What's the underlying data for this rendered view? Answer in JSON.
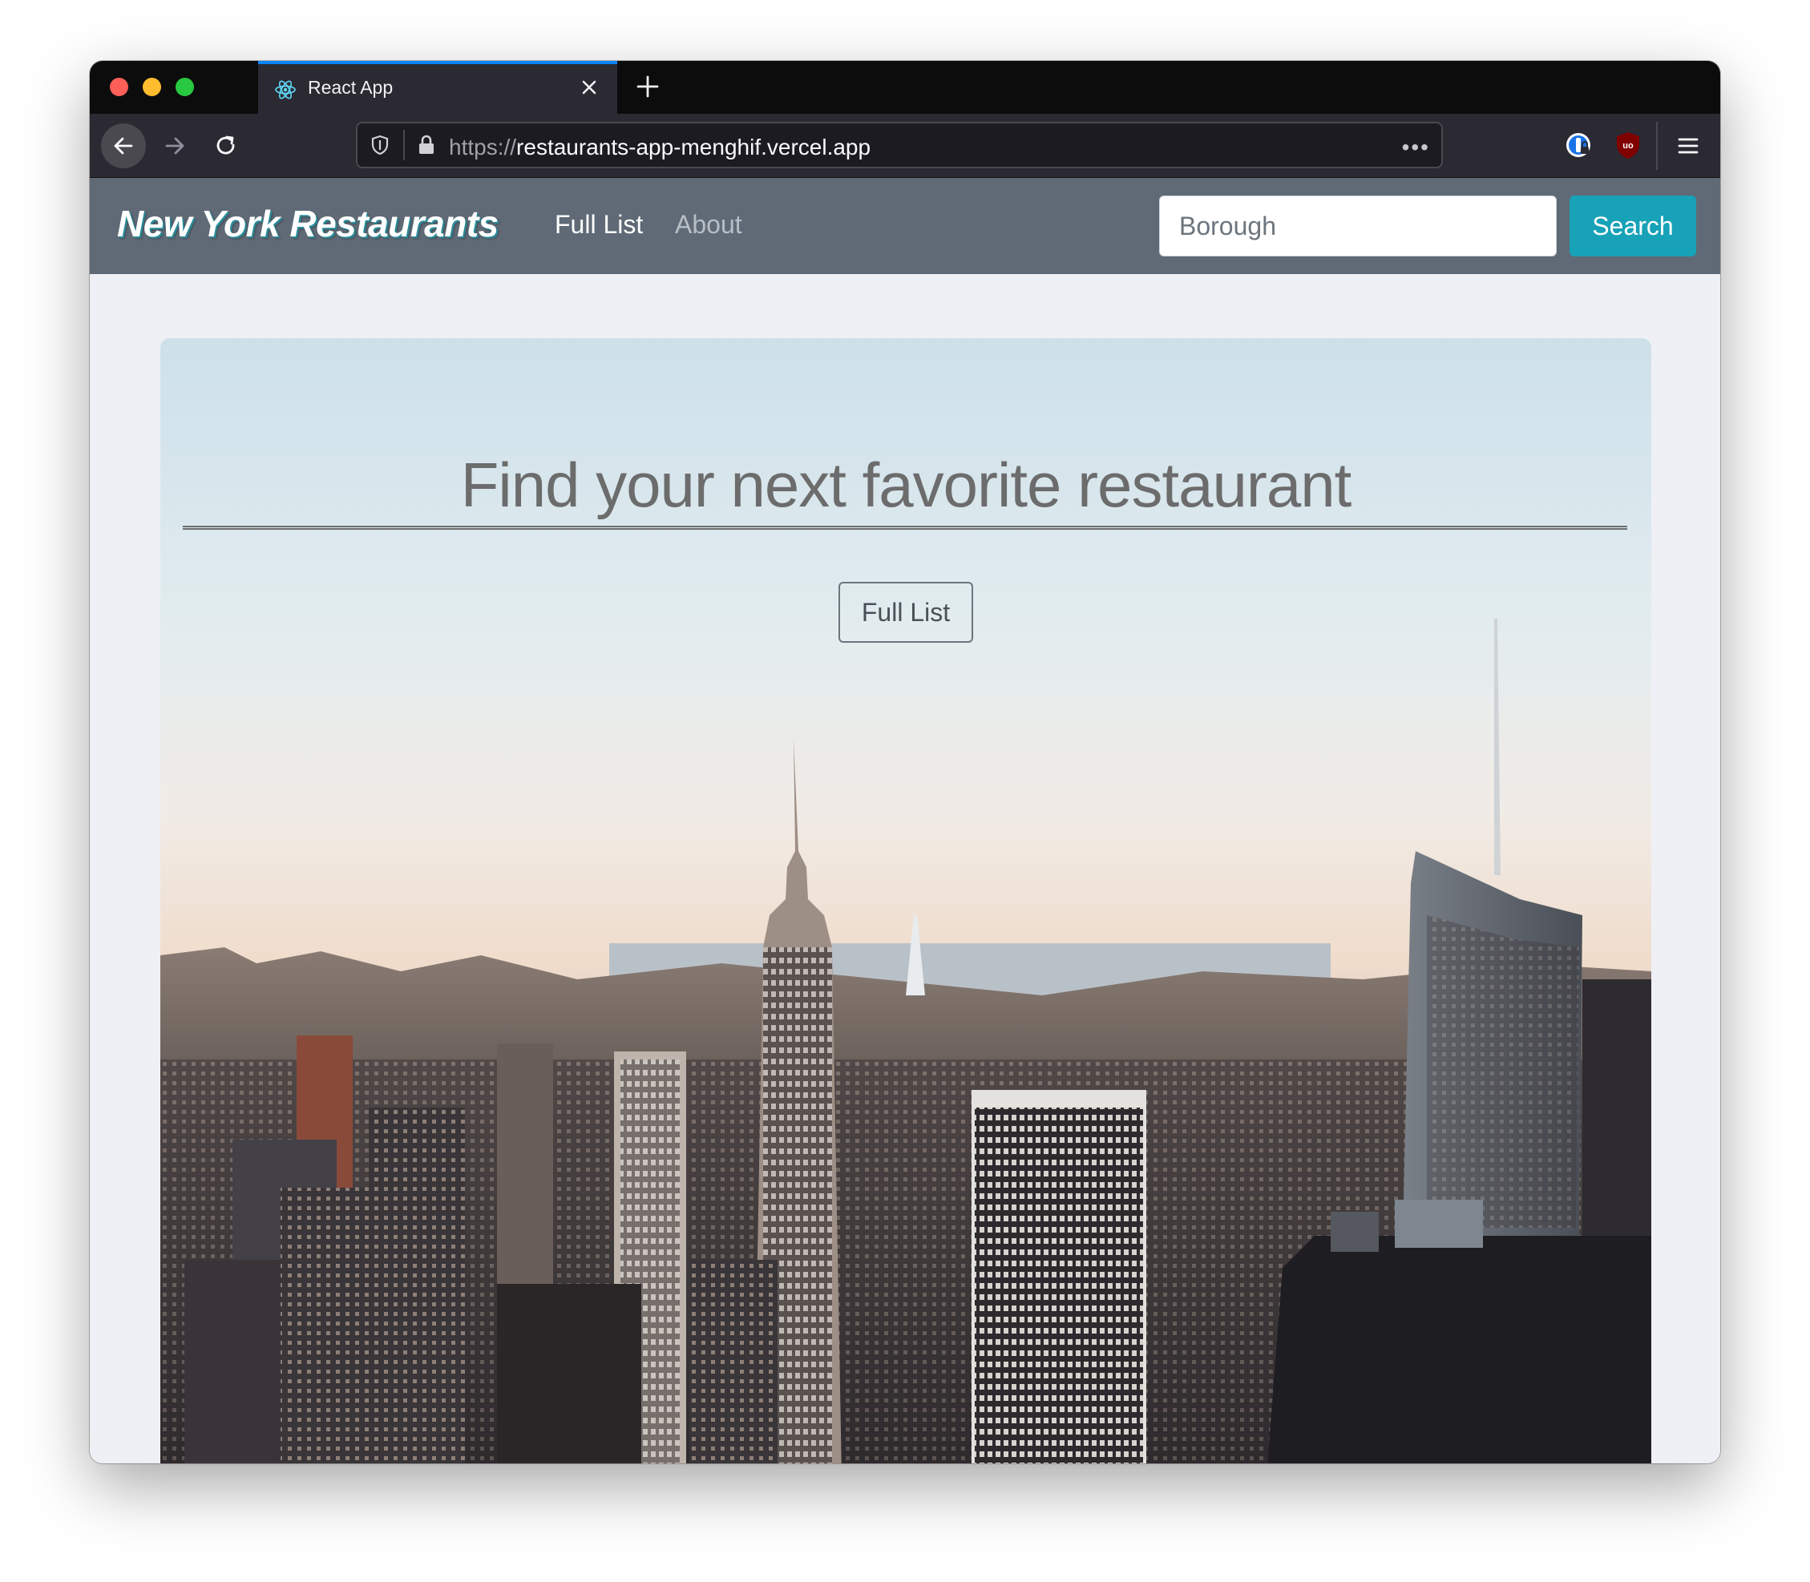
{
  "browser": {
    "tab_title": "React App",
    "url_scheme": "https://",
    "url_host": "restaurants-app-menghif.vercel.app",
    "url_more": "•••"
  },
  "navbar": {
    "brand": "New York Restaurants",
    "links": [
      "Full List",
      "About"
    ],
    "search_placeholder": "Borough",
    "search_button": "Search"
  },
  "hero": {
    "title": "Find your next favorite restaurant",
    "button": "Full List"
  },
  "colors": {
    "navbar_bg": "#5f6a76",
    "search_button": "#17a2b8",
    "brand_shadow": "#2a8a98",
    "tab_accent": "#0a84ff"
  }
}
